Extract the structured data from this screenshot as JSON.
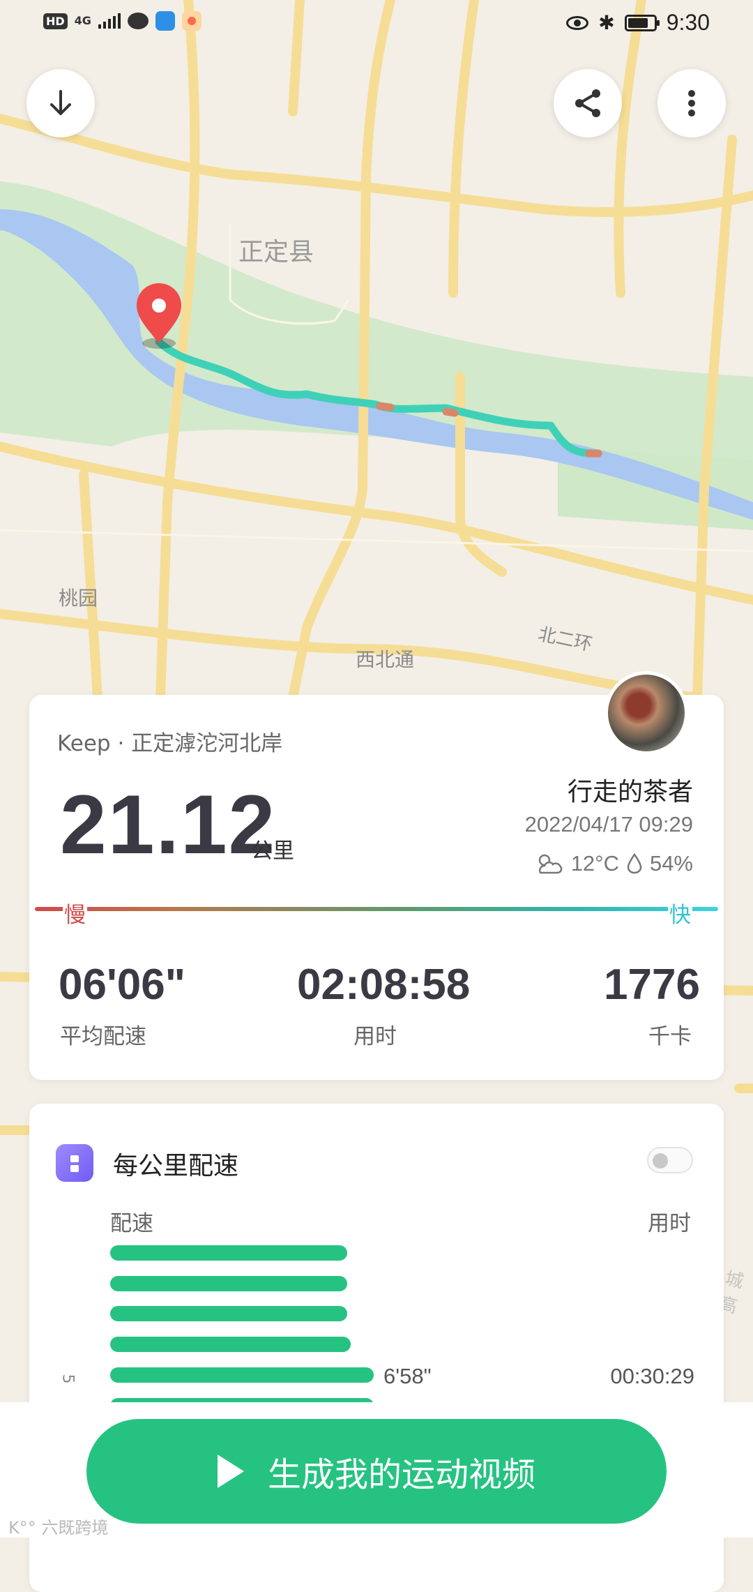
{
  "status_bar": {
    "network_hd": "HD",
    "network_type": "4G",
    "time": "9:30"
  },
  "map": {
    "place_labels": [
      "正定县",
      "桃园",
      "西北通",
      "北二环",
      "城高"
    ]
  },
  "summary": {
    "source": "Keep · 正定滹沱河北岸",
    "distance": "21.12",
    "distance_unit": "公里",
    "username": "行走的茶者",
    "datetime": "2022/04/17 09:29",
    "temperature": "12°C",
    "humidity": "54%",
    "pace_legend": {
      "slow": "慢",
      "fast": "快"
    },
    "stats": [
      {
        "value": "06'06\"",
        "label": "平均配速"
      },
      {
        "value": "02:08:58",
        "label": "用时"
      },
      {
        "value": "1776",
        "label": "千卡"
      }
    ]
  },
  "splits": {
    "title": "每公里配速",
    "col_pace": "配速",
    "col_time": "用时",
    "visible_row": {
      "km": "5",
      "pace": "6'58\"",
      "time": "00:30:29"
    }
  },
  "cta": {
    "label": "生成我的运动视频"
  },
  "watermark": "K°° 六既跨境",
  "colors": {
    "accent": "#26c281",
    "slow": "#d04a4a",
    "fast": "#3ed4e2",
    "route": "#3fd1b8"
  }
}
